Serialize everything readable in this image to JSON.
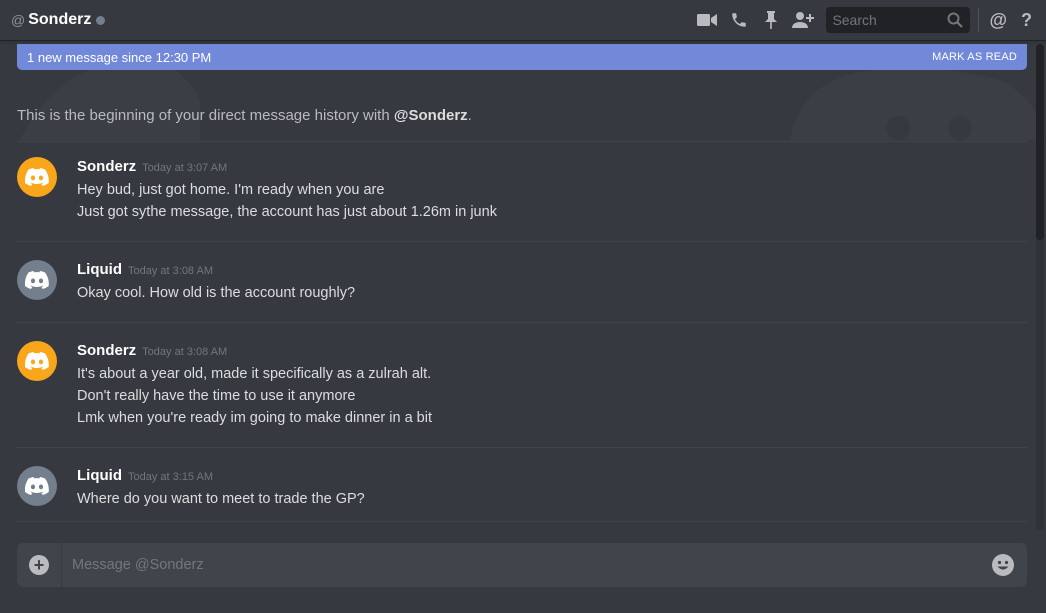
{
  "header": {
    "at": "@",
    "channel_name": "Sonderz",
    "search_placeholder": "Search",
    "icons": [
      "video-call-icon",
      "voice-call-icon",
      "pin-icon",
      "add-friend-icon",
      "search-icon",
      "mention-icon",
      "help-icon"
    ]
  },
  "new_messages_bar": {
    "text": "1 new message since 12:30 PM",
    "mark_as_read": "MARK AS READ"
  },
  "intro": {
    "prefix": "This is the beginning of your direct message history with ",
    "mention": "@Sonderz",
    "suffix": "."
  },
  "messages": [
    {
      "author": "Sonderz",
      "timestamp": "Today at 3:07 AM",
      "avatar_color": "#faa61a",
      "lines": [
        "Hey bud, just got home. I'm ready when you are",
        "Just got sythe message, the account has just about 1.26m in junk"
      ]
    },
    {
      "author": "Liquid",
      "timestamp": "Today at 3:08 AM",
      "avatar_color": "#747f8d",
      "lines": [
        "Okay cool. How old is the account roughly?"
      ]
    },
    {
      "author": "Sonderz",
      "timestamp": "Today at 3:08 AM",
      "avatar_color": "#faa61a",
      "lines": [
        "It's about a year old, made it specifically as a zulrah alt.",
        "Don't really have the time to use it anymore",
        "Lmk when you're ready im going to make dinner in a bit"
      ]
    },
    {
      "author": "Liquid",
      "timestamp": "Today at 3:15 AM",
      "avatar_color": "#747f8d",
      "lines": [
        "Where do you want to meet to trade the GP?"
      ]
    }
  ],
  "composer": {
    "placeholder": "Message @Sonderz"
  },
  "colors": {
    "background": "#36393f",
    "accent": "#7289da",
    "input": "#40444b"
  }
}
